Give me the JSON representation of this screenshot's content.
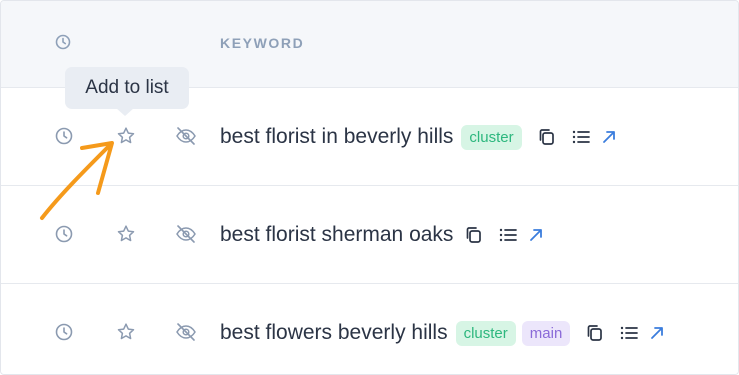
{
  "header": {
    "keyword_label": "KEYWORD",
    "sort_icon": "clock-icon"
  },
  "tooltip": {
    "text": "Add to list"
  },
  "rows": [
    {
      "keyword": "best florist in beverly hills",
      "badges": [
        "cluster"
      ]
    },
    {
      "keyword": "best florist sherman oaks",
      "badges": []
    },
    {
      "keyword": "best flowers beverly hills",
      "badges": [
        "cluster",
        "main"
      ]
    }
  ],
  "row_icons": [
    "clock-icon",
    "star-icon",
    "eye-off-icon"
  ],
  "action_icons": [
    "copy-icon",
    "list-icon",
    "external-link-icon"
  ],
  "colors": {
    "accent_blue": "#3b7ddd",
    "icon_gray": "#8b9ab0",
    "cluster_bg": "#d7f5e5",
    "cluster_text": "#2db77e",
    "main_bg": "#ece6fb",
    "main_text": "#8a6ad8",
    "annotation_arrow": "#f59a1b"
  }
}
